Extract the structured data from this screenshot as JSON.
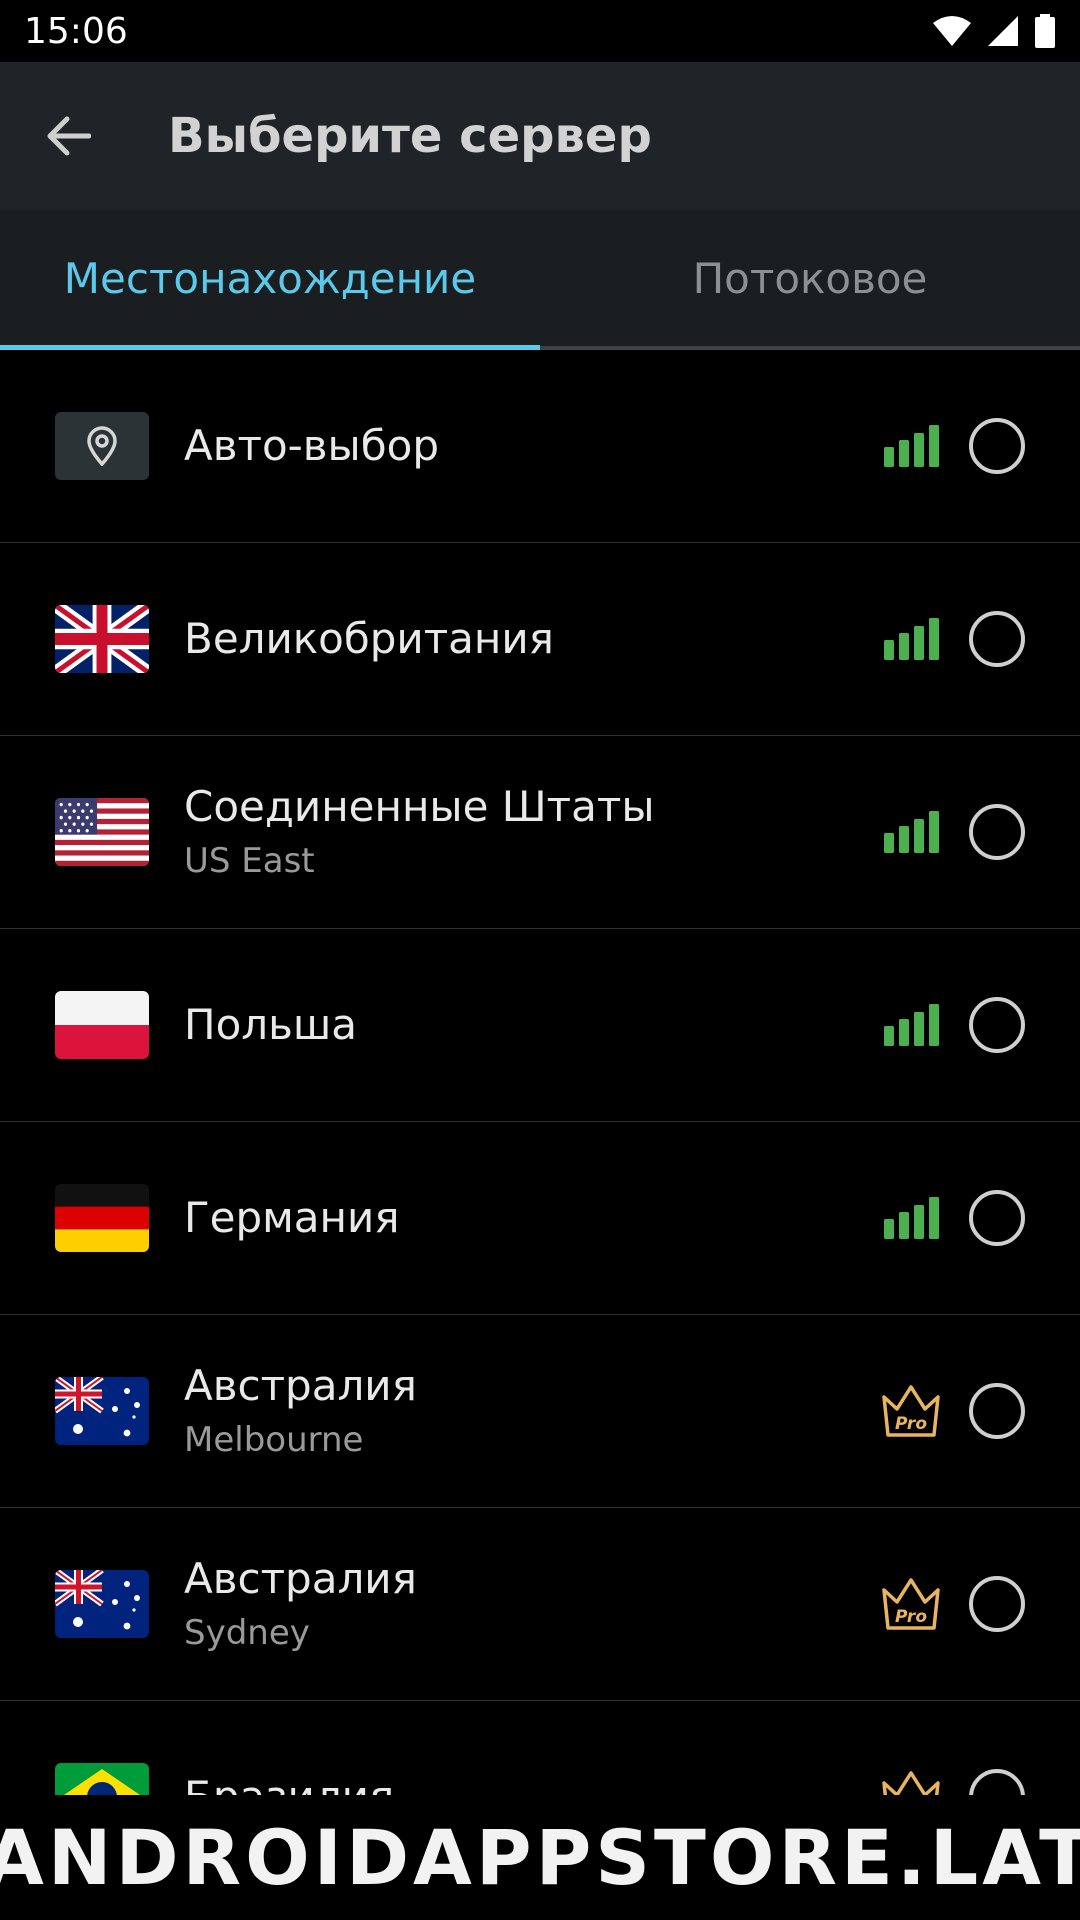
{
  "status_bar": {
    "time": "15:06"
  },
  "app_bar": {
    "title": "Выберите сервер"
  },
  "tabs": [
    {
      "label": "Местонахождение",
      "active": true
    },
    {
      "label": "Потоковое",
      "active": false
    }
  ],
  "servers": [
    {
      "name": "Авто-выбор",
      "sub": "",
      "flag": "auto-location-icon",
      "badge": "signal"
    },
    {
      "name": "Великобритания",
      "sub": "",
      "flag": "uk-flag-icon",
      "badge": "signal"
    },
    {
      "name": "Соединенные Штаты",
      "sub": "US East",
      "flag": "us-flag-icon",
      "badge": "signal"
    },
    {
      "name": "Польша",
      "sub": "",
      "flag": "poland-flag-icon",
      "badge": "signal"
    },
    {
      "name": "Германия",
      "sub": "",
      "flag": "germany-flag-icon",
      "badge": "signal"
    },
    {
      "name": "Австралия",
      "sub": "Melbourne",
      "flag": "australia-flag-icon",
      "badge": "pro"
    },
    {
      "name": "Австралия",
      "sub": "Sydney",
      "flag": "australia-flag-icon",
      "badge": "pro"
    },
    {
      "name": "Бразилия",
      "sub": "",
      "flag": "brazil-flag-icon",
      "badge": "pro"
    }
  ],
  "pro_badge_label": "Pro",
  "watermark": "ANDROIDAPPSTORE.LAT",
  "colors": {
    "accent": "#5bc9ea",
    "signal": "#4caf50",
    "pro": "#e8b461",
    "app_bar": "#202428"
  }
}
